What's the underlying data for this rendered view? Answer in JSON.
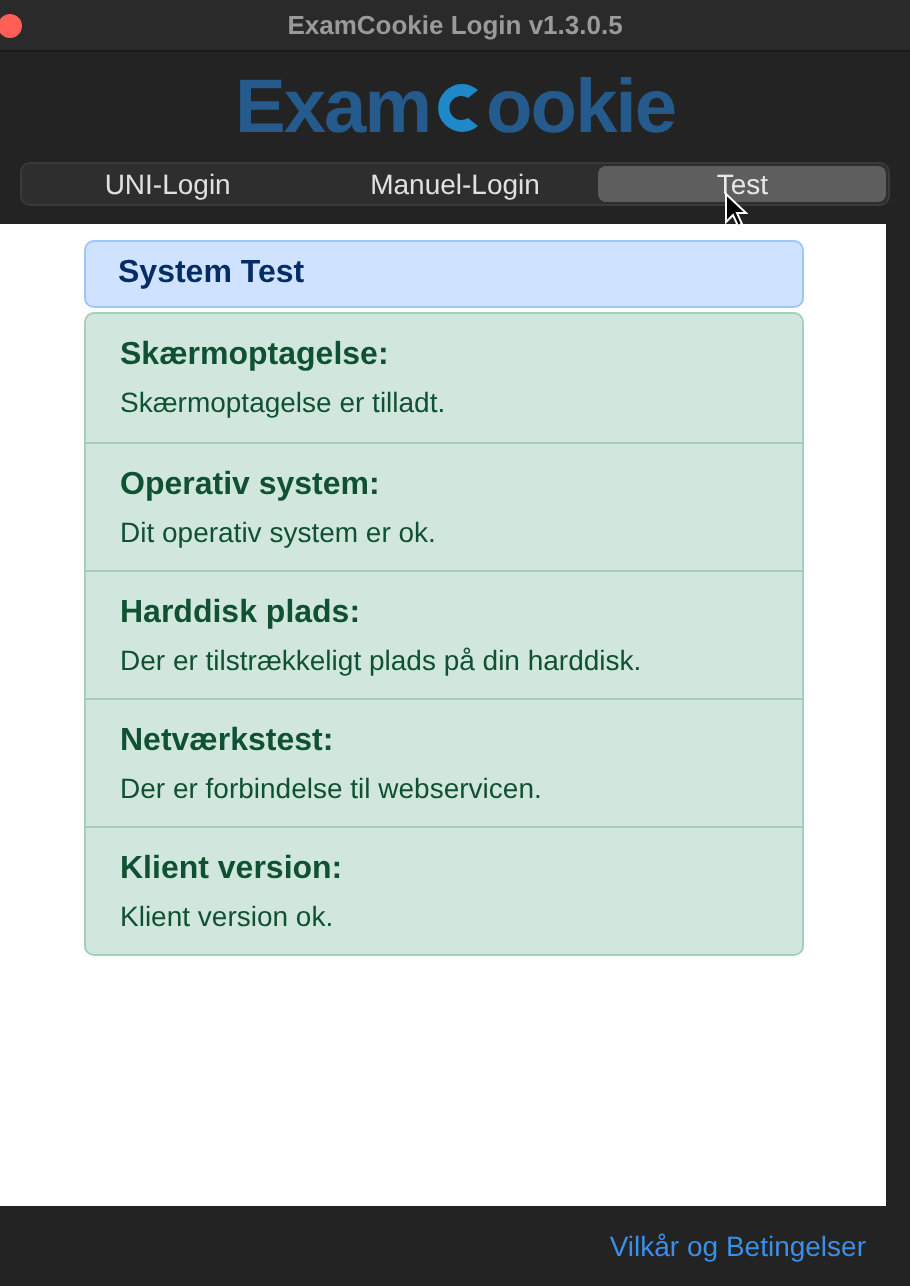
{
  "window": {
    "title": "ExamCookie Login v1.3.0.5"
  },
  "logo": {
    "before": "Exam",
    "after": "ookie"
  },
  "tabs": [
    {
      "label": "UNI-Login",
      "selected": false
    },
    {
      "label": "Manuel-Login",
      "selected": false
    },
    {
      "label": "Test",
      "selected": true
    }
  ],
  "system_test": {
    "title": "System Test",
    "checks": [
      {
        "title": "Skærmoptagelse:",
        "message": "Skærmoptagelse er tilladt."
      },
      {
        "title": "Operativ system:",
        "message": "Dit operativ system er ok."
      },
      {
        "title": "Harddisk plads:",
        "message": "Der er tilstrækkeligt plads på din harddisk."
      },
      {
        "title": "Netværkstest:",
        "message": "Der er forbindelse til webservicen."
      },
      {
        "title": "Klient version:",
        "message": "Klient version ok."
      }
    ]
  },
  "footer_link": "Vilkår og Betingelser"
}
